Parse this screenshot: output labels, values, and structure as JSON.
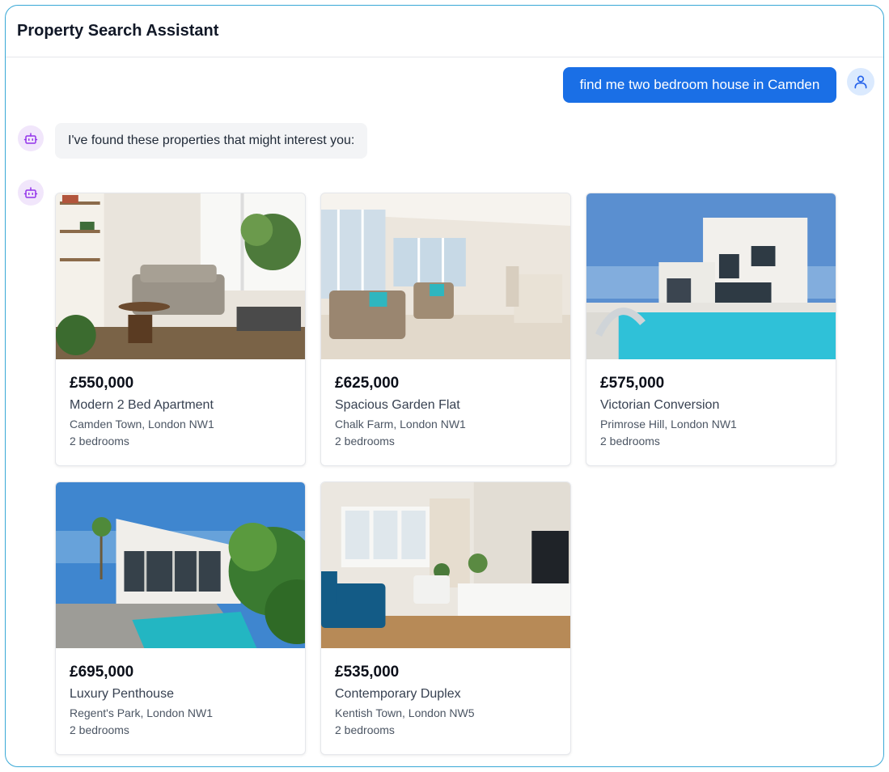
{
  "app": {
    "title": "Property Search Assistant"
  },
  "chat": {
    "user_message": "find me two bedroom house in Camden",
    "bot_message": "I've found these properties that might interest you:"
  },
  "icons": {
    "user": "user-icon",
    "bot": "robot-icon"
  },
  "colors": {
    "user_bubble": "#1a6fe6",
    "frame_border": "#38a8d6",
    "bot_avatar_bg": "#f1e6fb",
    "user_avatar_bg": "#dbeafe"
  },
  "properties": [
    {
      "price": "£550,000",
      "name": "Modern 2 Bed Apartment",
      "location": "Camden Town, London NW1",
      "bedrooms": "2 bedrooms"
    },
    {
      "price": "£625,000",
      "name": "Spacious Garden Flat",
      "location": "Chalk Farm, London NW1",
      "bedrooms": "2 bedrooms"
    },
    {
      "price": "£575,000",
      "name": "Victorian Conversion",
      "location": "Primrose Hill, London NW1",
      "bedrooms": "2 bedrooms"
    },
    {
      "price": "£695,000",
      "name": "Luxury Penthouse",
      "location": "Regent's Park, London NW1",
      "bedrooms": "2 bedrooms"
    },
    {
      "price": "£535,000",
      "name": "Contemporary Duplex",
      "location": "Kentish Town, London NW5",
      "bedrooms": "2 bedrooms"
    }
  ]
}
